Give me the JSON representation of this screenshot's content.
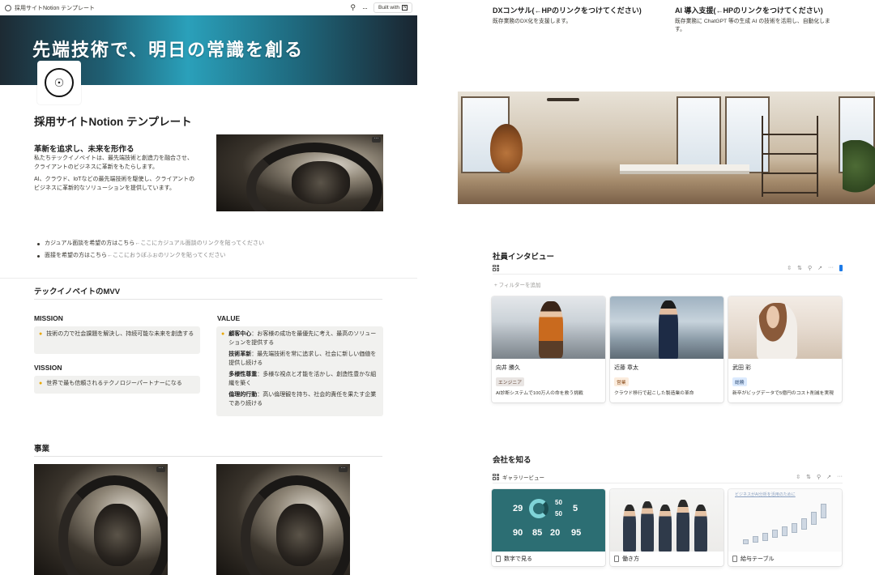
{
  "topbar": {
    "breadcrumb": "採用サイトNotion テンプレート",
    "built_with": "Built with"
  },
  "cover": {
    "headline": "先端技術で、明日の常識を創る"
  },
  "page": {
    "title": "採用サイトNotion テンプレート",
    "icon": "company-logo-icon"
  },
  "intro": {
    "heading": "革新を追求し、未来を形作る",
    "p1": "私たちテックイノベイトは、最先端技術と創造力を融合させ、クライアントのビジネスに革新をもたらします。",
    "p2": "AI、クラウド、IoTなどの最先端技術を駆使し、クライアントのビジネスに革新的なソリューションを提供しています。"
  },
  "links": [
    {
      "text": "カジュアル面談を希望の方はこちら",
      "hint": "←ここにカジュアル面談のリンクを貼ってください"
    },
    {
      "text": "面接を希望の方はこちら",
      "hint": "←ここにおうぼふぉのリンクを貼ってください"
    }
  ],
  "mvv": {
    "heading": "テックイノベイトのMVV",
    "mission_label": "MISSION",
    "mission_text": "技術の力で社会課題を解決し、持続可能な未来を創造する",
    "vision_label": "VISSION",
    "vision_text": "世界で最も信頼されるテクノロジーパートナーになる",
    "value_label": "VALUE",
    "values": [
      {
        "title": "顧客中心",
        "text": "：お客様の成功を最優先に考え、最高のソリューションを提供する"
      },
      {
        "title": "技術革新",
        "text": "：最先端技術を常に追求し、社会に新しい価値を提供し続ける"
      },
      {
        "title": "多様性尊重",
        "text": "：多様な視点と才能を活かし、創造性豊かな組織を築く"
      },
      {
        "title": "倫理的行動",
        "text": "：高い倫理観を持ち、社会的責任を果たす企業であり続ける"
      }
    ]
  },
  "business": {
    "heading": "事業"
  },
  "services": [
    {
      "title": "DXコンサル(←HPのリンクをつけてください)",
      "desc": "既存業務のDX化を支援します。"
    },
    {
      "title": "AI 導入支援(←HPのリンクをつけてください)",
      "desc": "既存業務に ChatGPT 等の生成 AI の技術を活用し、自動化します。"
    }
  ],
  "interviews": {
    "heading": "社員インタビュー",
    "filter_add": "+ フィルターを追加",
    "cards": [
      {
        "name": "向井 勝久",
        "tag": "エンジニア",
        "tag_bg": "#e9e5e3",
        "tag_fg": "#64473a",
        "desc": "AI診断システムで100万人の命を救う挑戦"
      },
      {
        "name": "近藤 章太",
        "tag": "営業",
        "tag_bg": "#fbecdd",
        "tag_fg": "#8a4d1c",
        "desc": "クラウド移行で起こした製造業の革命"
      },
      {
        "name": "武田 彩",
        "tag": "総務",
        "tag_bg": "#dbeafe",
        "tag_fg": "#28456c",
        "desc": "新卒がビッグデータで5億円のコスト削減を実現"
      }
    ]
  },
  "company": {
    "heading": "会社を知る",
    "view_label": "ギャラリービュー",
    "cards": [
      {
        "label": "数字で見る",
        "stats": [
          "29",
          "50",
          "5",
          "50",
          "90",
          "85",
          "20",
          "95"
        ]
      },
      {
        "label": "働き方"
      },
      {
        "label": "給与テーブル",
        "img_title": "ビジネスがAI分析を活用のために"
      }
    ]
  },
  "toolbar_icons": [
    "filter-icon",
    "sort-icon",
    "search-icon",
    "expand-icon",
    "more-icon"
  ]
}
